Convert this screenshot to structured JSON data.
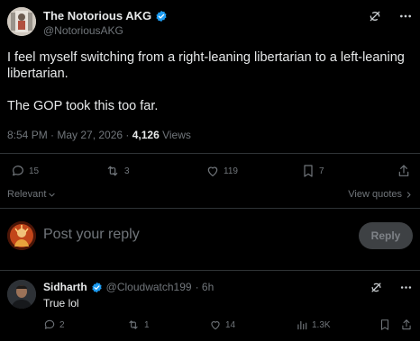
{
  "tweet": {
    "author_name": "The Notorious AKG",
    "author_handle": "@NotoriousAKG",
    "text_line1": "I feel myself switching from a right-leaning libertarian to a left-leaning",
    "text_line2": "libertarian.",
    "text_line3": "The GOP took this too far.",
    "time": "8:54 PM · May 27, 2026 · ",
    "views_count": "4,126",
    "views_label": " Views",
    "stats": {
      "replies": "15",
      "reposts": "3",
      "likes": "119",
      "bookmarks": "7"
    }
  },
  "sort": {
    "relevant_label": "Relevant",
    "view_quotes_label": "View quotes"
  },
  "composer": {
    "placeholder": "Post your reply",
    "reply_button": "Reply"
  },
  "reply": {
    "author_name": "Sidharth",
    "author_handle": "@Cloudwatch199",
    "time": "· 6h",
    "text": "True lol",
    "stats": {
      "replies": "2",
      "reposts": "1",
      "likes": "14",
      "views": "1.3K"
    }
  },
  "colors": {
    "background": "#000000",
    "text": "#e7e9ea",
    "muted": "#71767b",
    "verified": "#1d9bf0",
    "divider": "#2f3336"
  }
}
